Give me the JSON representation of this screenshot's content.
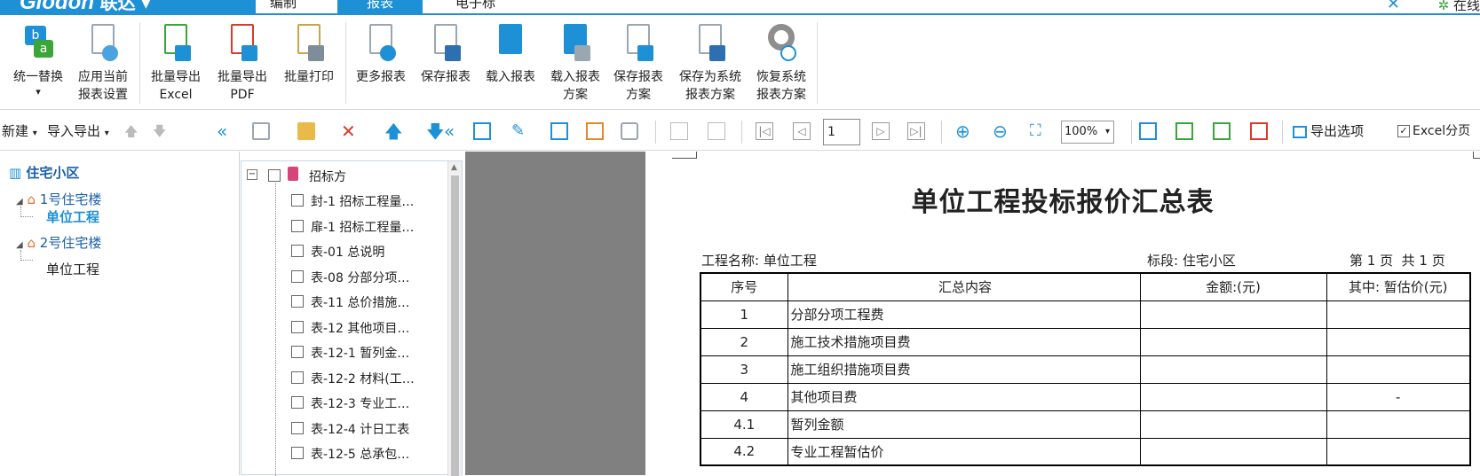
{
  "app": {
    "logo_text": "Glodon",
    "product": "联达",
    "menu_tabs": [
      "编制",
      "报表",
      "电子标"
    ],
    "active_tab": "报表",
    "online_label": "在线"
  },
  "ribbon": {
    "buttons": [
      {
        "label1": "统一替换",
        "label2": "▾",
        "icon": "replace-icon"
      },
      {
        "label1": "应用当前",
        "label2": "报表设置",
        "icon": "apply-settings-icon"
      },
      {
        "label1": "批量导出",
        "label2": "Excel",
        "icon": "excel-export-icon"
      },
      {
        "label1": "批量导出",
        "label2": "PDF",
        "icon": "pdf-export-icon"
      },
      {
        "label1": "批量打印",
        "label2": "",
        "icon": "batch-print-icon"
      },
      {
        "label1": "更多报表",
        "label2": "",
        "icon": "more-reports-icon"
      },
      {
        "label1": "保存报表",
        "label2": "",
        "icon": "save-report-icon"
      },
      {
        "label1": "载入报表",
        "label2": "",
        "icon": "load-report-icon"
      },
      {
        "label1": "载入报表",
        "label2": "方案",
        "icon": "load-scheme-icon"
      },
      {
        "label1": "保存报表",
        "label2": "方案",
        "icon": "save-scheme-icon"
      },
      {
        "label1": "保存为系统",
        "label2": "报表方案",
        "icon": "save-system-scheme-icon"
      },
      {
        "label1": "恢复系统",
        "label2": "报表方案",
        "icon": "restore-system-icon"
      }
    ]
  },
  "toolbar": {
    "new_label": "新建",
    "import_export_label": "导入导出",
    "page_value": "1",
    "zoom_value": "100%",
    "export_options_label": "导出选项",
    "excel_paging_label": "Excel分页"
  },
  "project_tree": {
    "root": "住宅小区",
    "building1": "1号住宅楼",
    "unit1": "单位工程",
    "building2": "2号住宅楼",
    "unit2": "单位工程"
  },
  "report_tree": {
    "root": "招标方",
    "items": [
      "封-1 招标工程量…",
      "扉-1 招标工程量…",
      "表-01 总说明",
      "表-08 分部分项…",
      "表-11 总价措施…",
      "表-12 其他项目…",
      "表-12-1 暂列金…",
      "表-12-2 材料(工…",
      "表-12-3 专业工…",
      "表-12-4 计日工表",
      "表-12-5 总承包…"
    ]
  },
  "report": {
    "title": "单位工程投标报价汇总表",
    "project_name": "工程名称: 单位工程",
    "section": "标段: 住宅小区",
    "page_info": "第 1 页  共 1 页",
    "headers": [
      "序号",
      "汇总内容",
      "金额:(元)",
      "其中: 暂估价(元)"
    ],
    "rows": [
      {
        "no": "1",
        "content": "分部分项工程费",
        "amount": "",
        "estimate": ""
      },
      {
        "no": "2",
        "content": "施工技术措施项目费",
        "amount": "",
        "estimate": ""
      },
      {
        "no": "3",
        "content": "施工组织措施项目费",
        "amount": "",
        "estimate": ""
      },
      {
        "no": "4",
        "content": "其他项目费",
        "amount": "",
        "estimate": "-"
      },
      {
        "no": "4.1",
        "content": "暂列金额",
        "amount": "",
        "estimate": ""
      },
      {
        "no": "4.2",
        "content": "专业工程暂估价",
        "amount": "",
        "estimate": ""
      }
    ]
  }
}
